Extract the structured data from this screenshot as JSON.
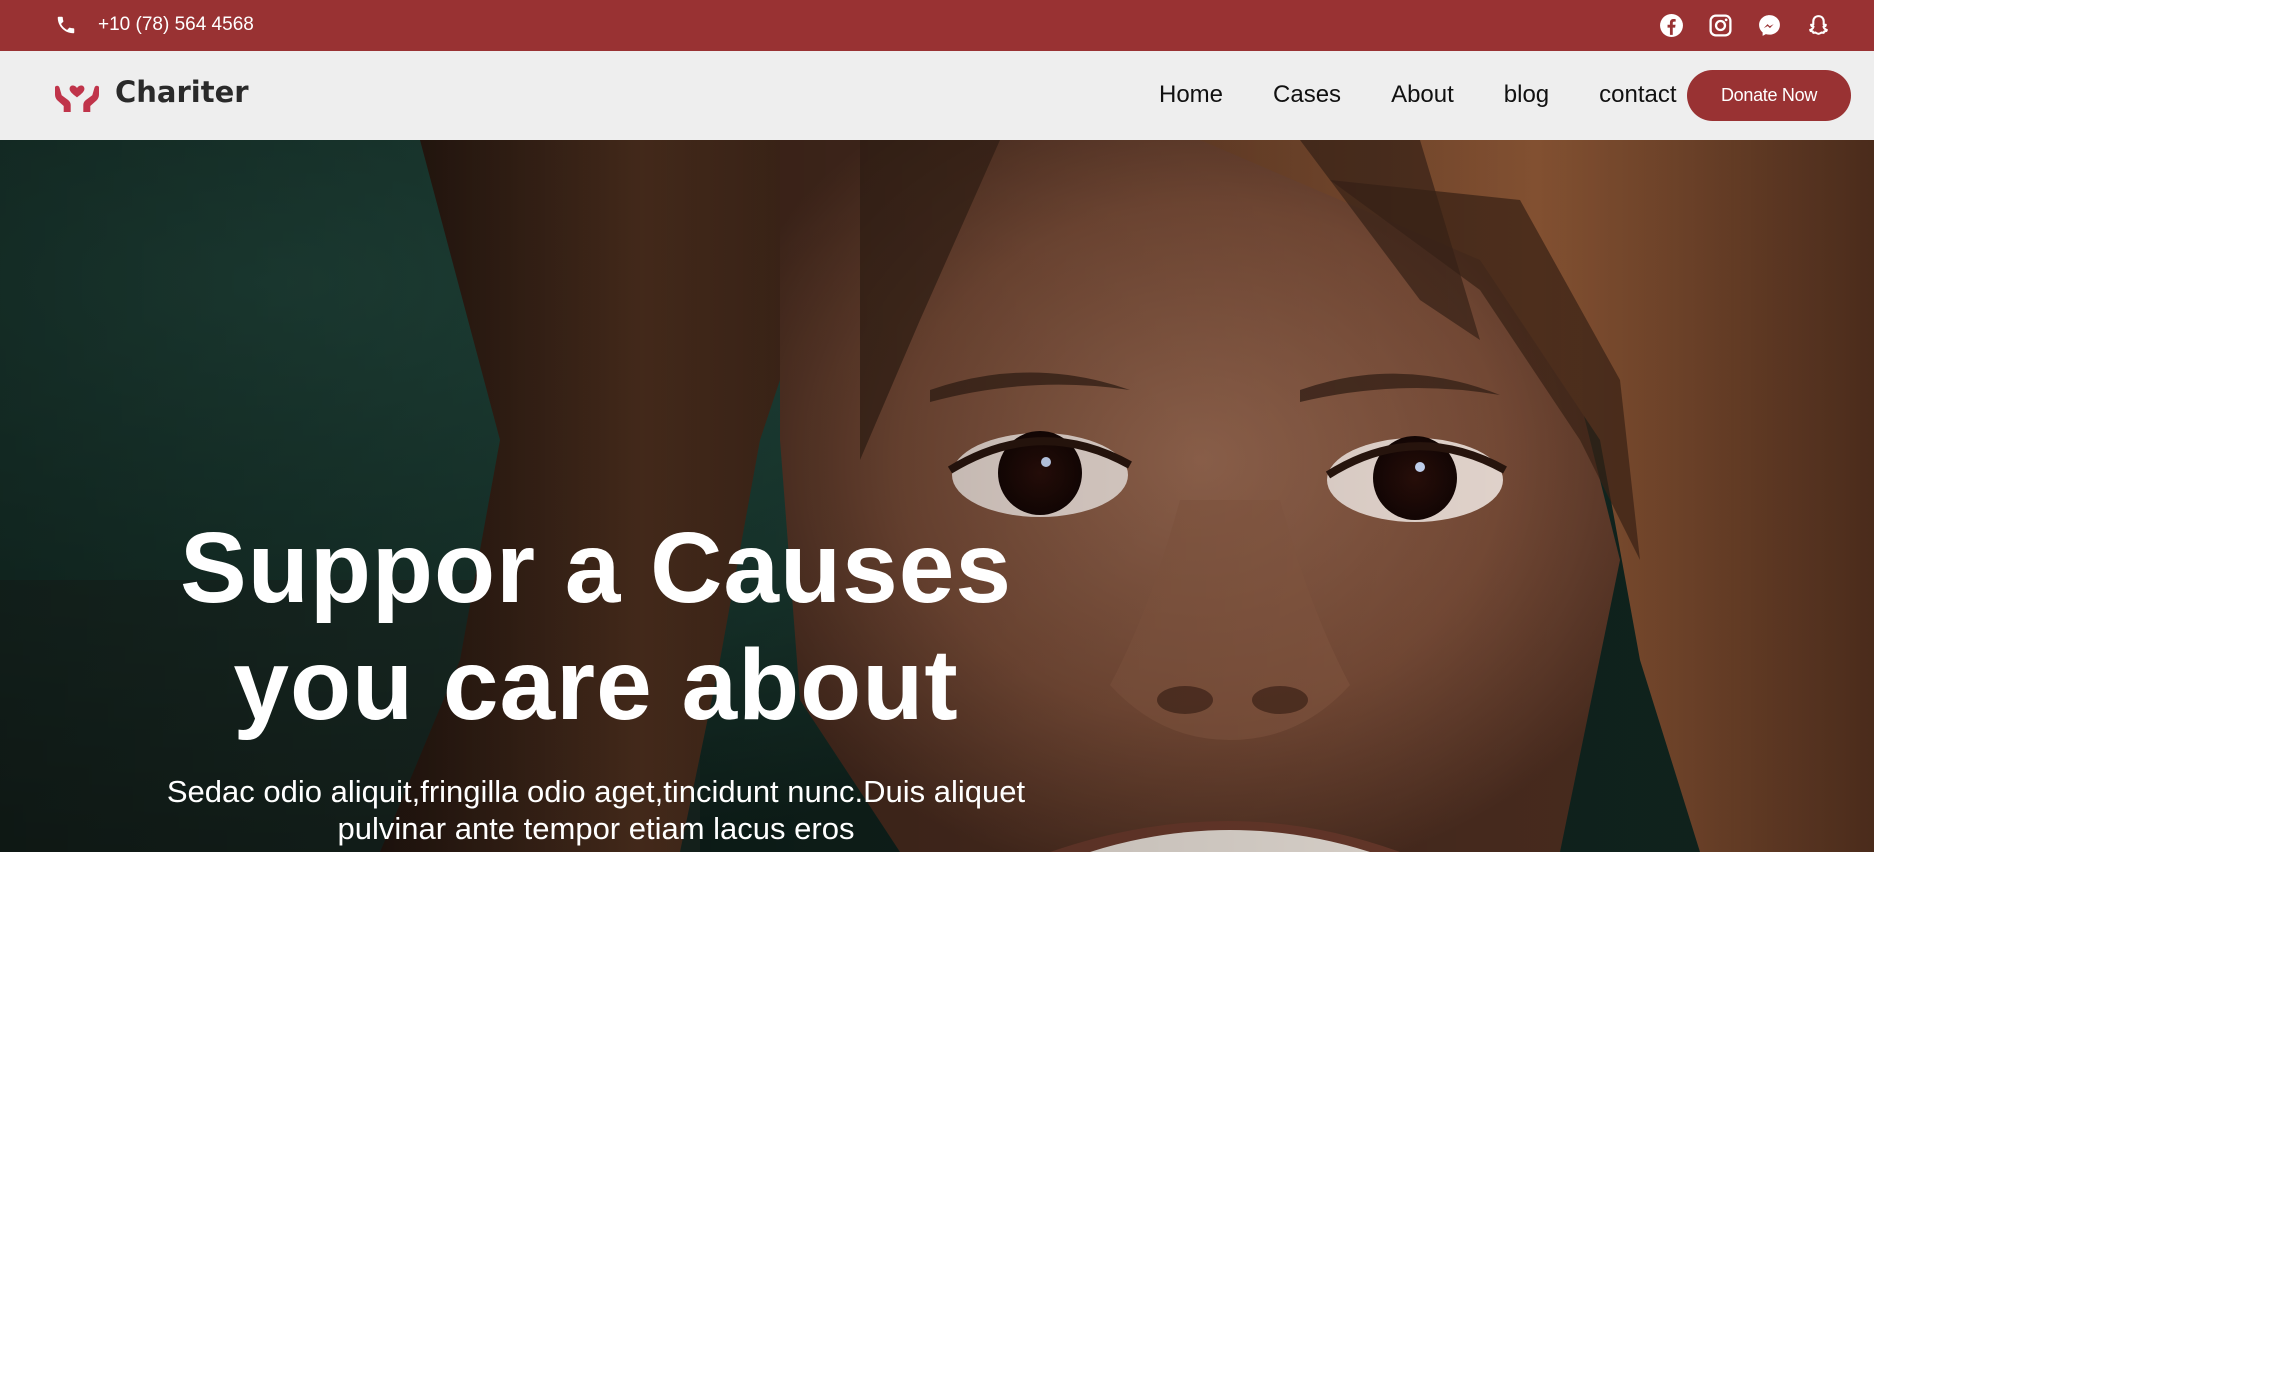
{
  "topbar": {
    "phone": "+10 (78) 564 4568",
    "socials": [
      "facebook-icon",
      "instagram-icon",
      "messenger-icon",
      "snapchat-icon"
    ]
  },
  "brand": {
    "name": "Chariter",
    "logo_icon": "heart-hands-icon"
  },
  "nav": {
    "items": [
      "Home",
      "Cases",
      "About",
      "blog",
      "contact"
    ],
    "donate_label": "Donate Now"
  },
  "hero": {
    "title_line1": "Suppor a Causes",
    "title_line2": "you care about",
    "subtitle_line1": "Sedac odio aliquit,fringilla odio aget,tincidunt nunc.Duis aliquet",
    "subtitle_line2": "pulvinar ante tempor etiam lacus eros"
  },
  "colors": {
    "brand_red": "#993233",
    "nav_bg": "#eeeeee",
    "text_dark": "#111111"
  }
}
